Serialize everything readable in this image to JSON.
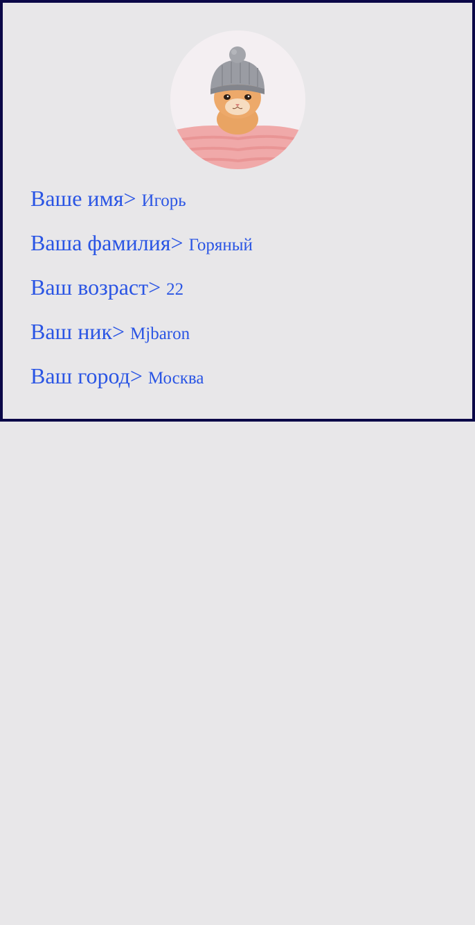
{
  "profile": {
    "avatar_icon": "kitten-in-knit-hat-photo",
    "fields": [
      {
        "label": "Ваше имя>",
        "value": "Игорь"
      },
      {
        "label": "Ваша фамилия>",
        "value": "Горяный"
      },
      {
        "label": "Ваш возраст>",
        "value": "22"
      },
      {
        "label": "Ваш ник>",
        "value": "Mjbaron"
      },
      {
        "label": "Ваш город>",
        "value": "Москва"
      }
    ]
  },
  "colors": {
    "background": "#e8e7e9",
    "border": "#0b0848",
    "text": "#2a55e4"
  }
}
